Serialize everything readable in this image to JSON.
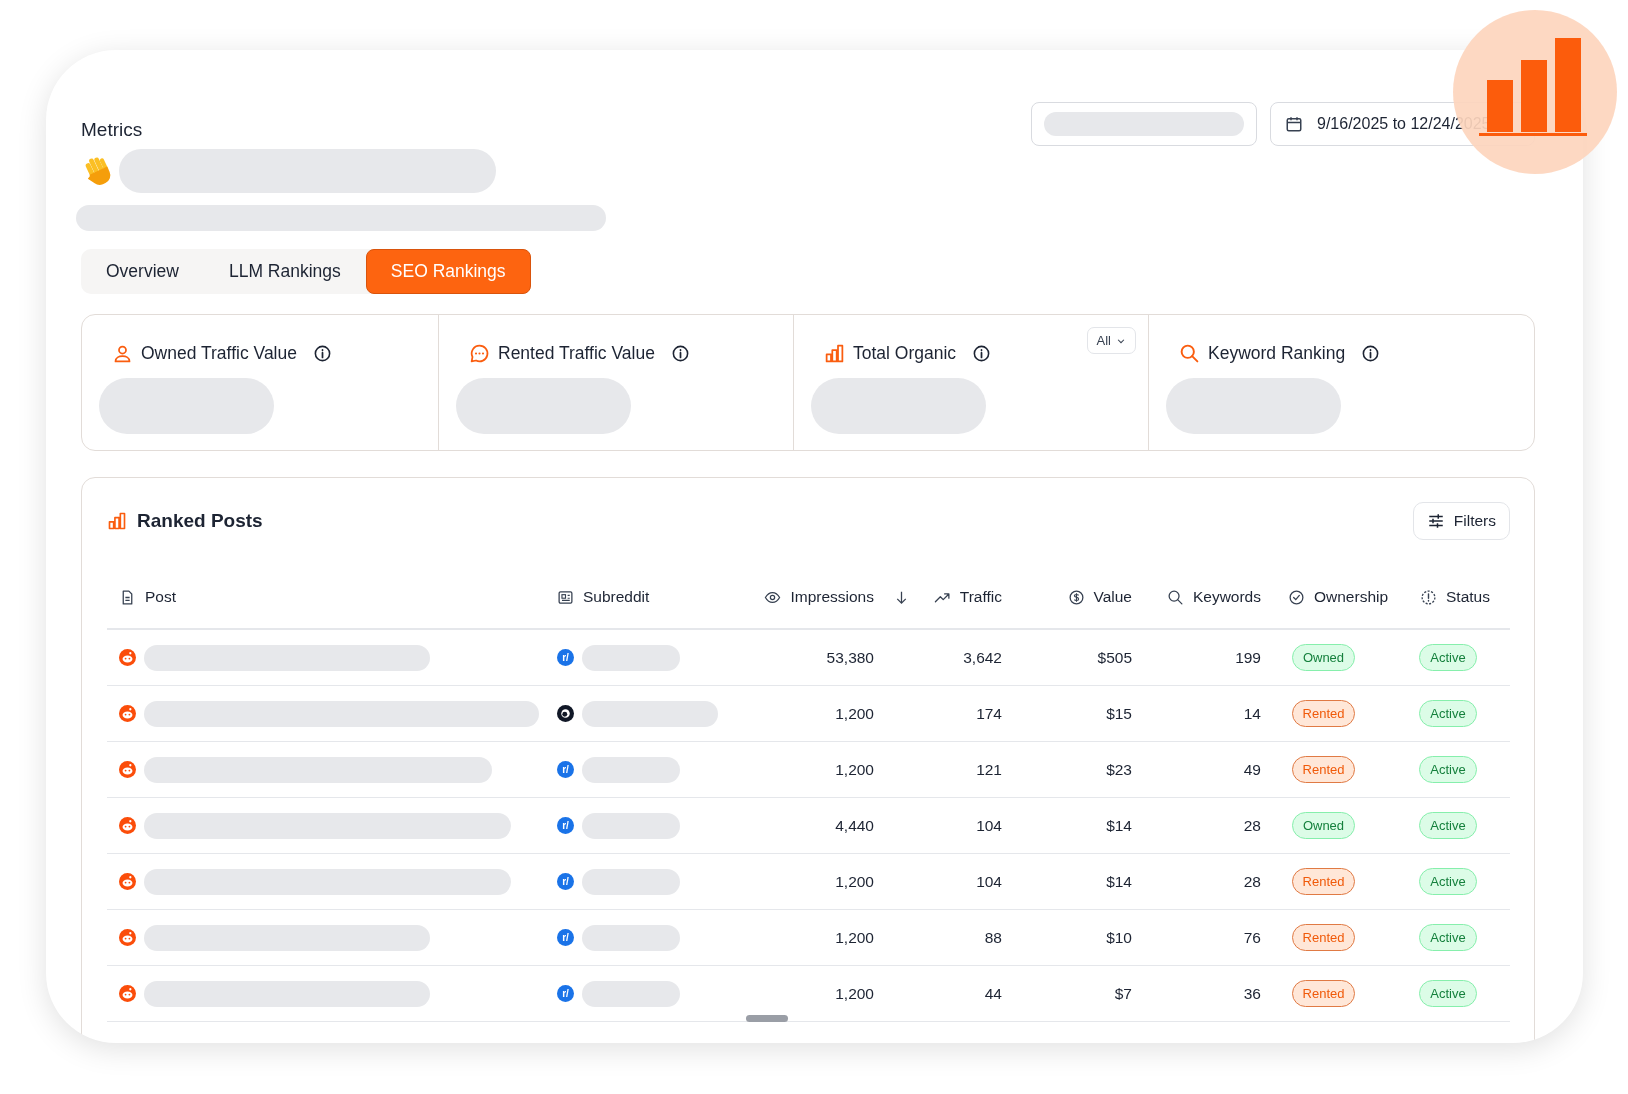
{
  "header": {
    "title": "Metrics",
    "date_range": {
      "value": "9/16/2025 to 12/24/2025"
    }
  },
  "tabs": [
    {
      "label": "Overview",
      "selected": false
    },
    {
      "label": "LLM Rankings",
      "selected": false
    },
    {
      "label": "SEO Rankings",
      "selected": true
    }
  ],
  "metric_cards": [
    {
      "kind": "owned",
      "title": "Owned Traffic Value"
    },
    {
      "kind": "rented",
      "title": "Rented Traffic Value"
    },
    {
      "kind": "organic",
      "title": "Total Organic",
      "filter": {
        "value": "All"
      }
    },
    {
      "kind": "keyword",
      "title": "Keyword Ranking"
    }
  ],
  "ranked_posts": {
    "title": "Ranked Posts",
    "filters_button": "Filters",
    "columns": [
      {
        "kind": "post",
        "label": "Post"
      },
      {
        "kind": "subreddit",
        "label": "Subreddit"
      },
      {
        "kind": "impressions",
        "label": "Impressions"
      },
      {
        "kind": "traffic",
        "label": "Traffic",
        "sorted": true
      },
      {
        "kind": "value",
        "label": "Value"
      },
      {
        "kind": "keywords",
        "label": "Keywords"
      },
      {
        "kind": "ownership",
        "label": "Ownership"
      },
      {
        "kind": "status",
        "label": "Status"
      }
    ],
    "rows": [
      {
        "subreddit": {
          "kind": "text",
          "icon_text": "r/"
        },
        "impressions": "53,380",
        "traffic": "3,642",
        "value": "$505",
        "keywords": "199",
        "ownership": {
          "label": "Owned",
          "kind": "owned"
        },
        "status": {
          "label": "Active",
          "kind": "active"
        }
      },
      {
        "subreddit": {
          "kind": "avatar"
        },
        "impressions": "1,200",
        "traffic": "174",
        "value": "$15",
        "keywords": "14",
        "ownership": {
          "label": "Rented",
          "kind": "rented"
        },
        "status": {
          "label": "Active",
          "kind": "active"
        }
      },
      {
        "subreddit": {
          "kind": "text",
          "icon_text": "r/"
        },
        "impressions": "1,200",
        "traffic": "121",
        "value": "$23",
        "keywords": "49",
        "ownership": {
          "label": "Rented",
          "kind": "rented"
        },
        "status": {
          "label": "Active",
          "kind": "active"
        }
      },
      {
        "subreddit": {
          "kind": "text",
          "icon_text": "r/"
        },
        "impressions": "4,440",
        "traffic": "104",
        "value": "$14",
        "keywords": "28",
        "ownership": {
          "label": "Owned",
          "kind": "owned"
        },
        "status": {
          "label": "Active",
          "kind": "active"
        }
      },
      {
        "subreddit": {
          "kind": "text",
          "icon_text": "r/"
        },
        "impressions": "1,200",
        "traffic": "104",
        "value": "$14",
        "keywords": "28",
        "ownership": {
          "label": "Rented",
          "kind": "rented"
        },
        "status": {
          "label": "Active",
          "kind": "active"
        }
      },
      {
        "subreddit": {
          "kind": "text",
          "icon_text": "r/"
        },
        "impressions": "1,200",
        "traffic": "88",
        "value": "$10",
        "keywords": "76",
        "ownership": {
          "label": "Rented",
          "kind": "rented"
        },
        "status": {
          "label": "Active",
          "kind": "active"
        }
      },
      {
        "subreddit": {
          "kind": "text",
          "icon_text": "r/"
        },
        "impressions": "1,200",
        "traffic": "44",
        "value": "$7",
        "keywords": "36",
        "ownership": {
          "label": "Rented",
          "kind": "rented"
        },
        "status": {
          "label": "Active",
          "kind": "active"
        }
      }
    ]
  }
}
